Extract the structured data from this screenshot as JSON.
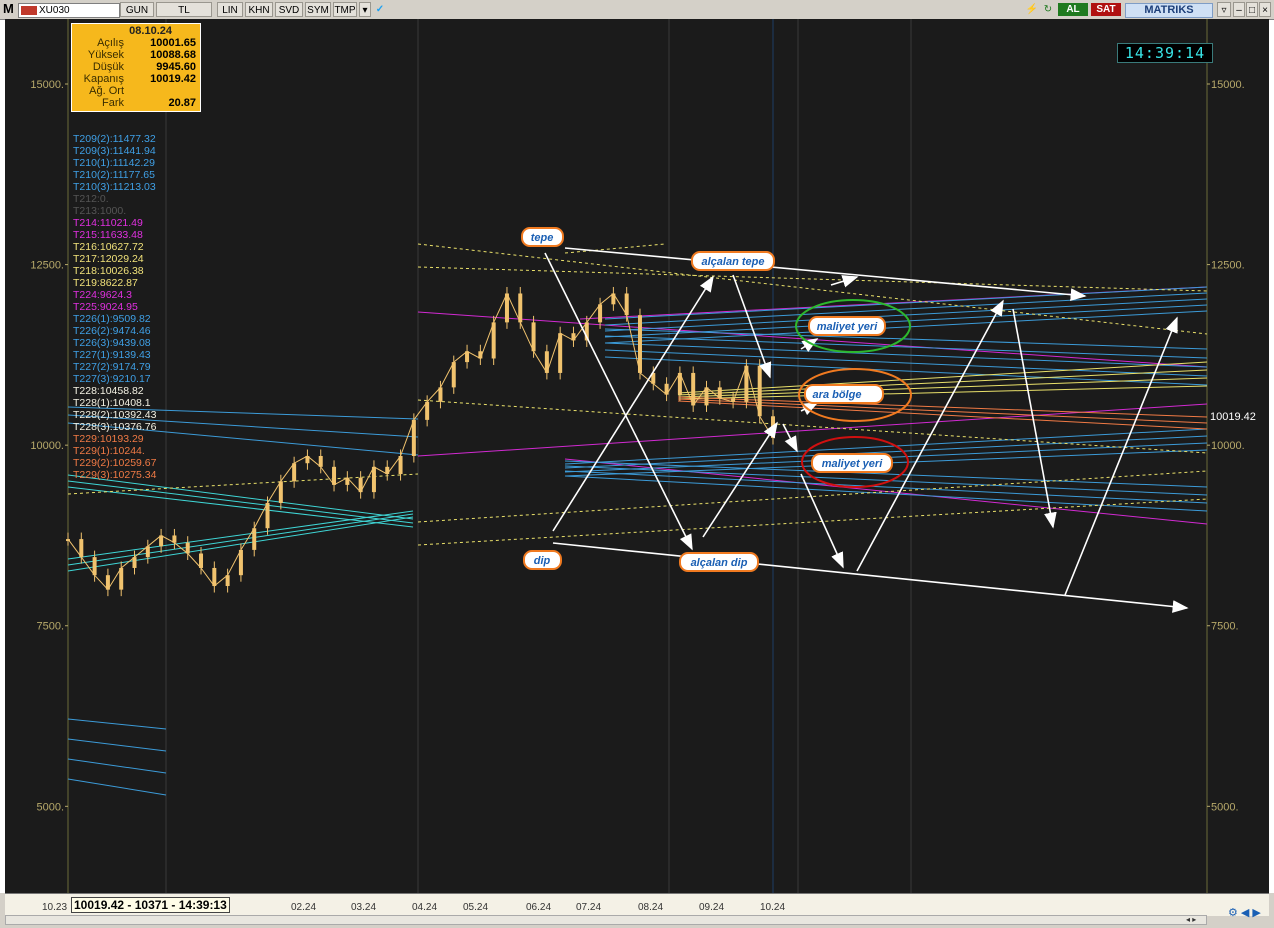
{
  "toolbar": {
    "logo": "M",
    "symbol": "XU030",
    "buttons": [
      "GUN",
      "TL",
      "LIN",
      "KHN",
      "SVD",
      "SYM",
      "TMP"
    ],
    "al_label": "AL",
    "sat_label": "SAT",
    "brand": "MATRIKS"
  },
  "clock": "14:39:14",
  "info_box": {
    "date": "08.10.24",
    "rows": [
      {
        "label": "Açılış",
        "value": "10001.65"
      },
      {
        "label": "Yüksek",
        "value": "10088.68"
      },
      {
        "label": "Düşük",
        "value": "9945.60"
      },
      {
        "label": "Kapanış",
        "value": "10019.42"
      },
      {
        "label": "Ağ. Ort",
        "value": ""
      },
      {
        "label": "Fark",
        "value": "20.87"
      }
    ]
  },
  "levels": [
    {
      "text": "T209(2):11477.32",
      "color": "#3fa0e6"
    },
    {
      "text": "T209(3):11441.94",
      "color": "#3fa0e6"
    },
    {
      "text": "T210(1):11142.29",
      "color": "#3fa0e6"
    },
    {
      "text": "T210(2):11177.65",
      "color": "#3fa0e6"
    },
    {
      "text": "T210(3):11213.03",
      "color": "#3fa0e6"
    },
    {
      "text": "T212:0.",
      "color": "#555555"
    },
    {
      "text": "T213:1000.",
      "color": "#555555"
    },
    {
      "text": "T214:11021.49",
      "color": "#e030e0"
    },
    {
      "text": "T215:11633.48",
      "color": "#e030e0"
    },
    {
      "text": "T216:10627.72",
      "color": "#f1e27a"
    },
    {
      "text": "T217:12029.24",
      "color": "#f1e27a"
    },
    {
      "text": "T218:10026.38",
      "color": "#f1e27a"
    },
    {
      "text": "T219:8622.87",
      "color": "#f1e27a"
    },
    {
      "text": "T224:9624.3",
      "color": "#e030e0"
    },
    {
      "text": "T225:9024.95",
      "color": "#e030e0"
    },
    {
      "text": "T226(1):9509.82",
      "color": "#3fa0e6"
    },
    {
      "text": "T226(2):9474.46",
      "color": "#3fa0e6"
    },
    {
      "text": "T226(3):9439.08",
      "color": "#3fa0e6"
    },
    {
      "text": "T227(1):9139.43",
      "color": "#3fa0e6"
    },
    {
      "text": "T227(2):9174.79",
      "color": "#3fa0e6"
    },
    {
      "text": "T227(3):9210.17",
      "color": "#3fa0e6"
    },
    {
      "text": "T228:10458.82",
      "color": "#f4f2e4"
    },
    {
      "text": "T228(1):10408.1",
      "color": "#f4f2e4"
    },
    {
      "text": "T228(2):10392.43",
      "color": "#f4f2e4"
    },
    {
      "text": "T228(3):10376.76",
      "color": "#f4f2e4"
    },
    {
      "text": "T229:10193.29",
      "color": "#f07a45"
    },
    {
      "text": "T229(1):10244.",
      "color": "#f07a45"
    },
    {
      "text": "T229(2):10259.67",
      "color": "#f07a45"
    },
    {
      "text": "T229(3):10275.34",
      "color": "#f07a45"
    }
  ],
  "annotations": {
    "tepe": "tepe",
    "alcalan_tepe": "alçalan tepe",
    "maliyet_yeri_top": "maliyet yeri",
    "ara_bolge": "ara bölge",
    "maliyet_yeri_bottom": "maliyet yeri",
    "dip": "dip",
    "alcalan_dip": "alçalan dip"
  },
  "status_readout": "10019.42 - 10371 - 14:39:13",
  "chart_data": {
    "type": "candlestick",
    "symbol": "XU030",
    "y_ticks": [
      15000,
      12500,
      10000,
      7500,
      5000
    ],
    "y_tick_labels": [
      "15000.",
      "12500.",
      "10000.",
      "7500.",
      "5000."
    ],
    "ylim": [
      3800,
      15900
    ],
    "last_price": "10019.42",
    "x_tick_labels": [
      "10.23",
      "02.24",
      "03.24",
      "04.24",
      "05.24",
      "06.24",
      "07.24",
      "08.24",
      "09.24",
      "10.24"
    ],
    "price_path": [
      [
        0,
        8700
      ],
      [
        2,
        8450
      ],
      [
        4,
        8200
      ],
      [
        6,
        8000
      ],
      [
        8,
        8300
      ],
      [
        10,
        8450
      ],
      [
        12,
        8600
      ],
      [
        14,
        8750
      ],
      [
        16,
        8650
      ],
      [
        18,
        8500
      ],
      [
        20,
        8300
      ],
      [
        22,
        8050
      ],
      [
        24,
        8200
      ],
      [
        26,
        8550
      ],
      [
        28,
        8850
      ],
      [
        30,
        9200
      ],
      [
        32,
        9500
      ],
      [
        34,
        9750
      ],
      [
        36,
        9850
      ],
      [
        38,
        9700
      ],
      [
        40,
        9450
      ],
      [
        42,
        9550
      ],
      [
        44,
        9350
      ],
      [
        46,
        9700
      ],
      [
        48,
        9600
      ],
      [
        50,
        9850
      ],
      [
        52,
        10350
      ],
      [
        54,
        10600
      ],
      [
        56,
        10800
      ],
      [
        58,
        11150
      ],
      [
        60,
        11300
      ],
      [
        62,
        11200
      ],
      [
        64,
        11700
      ],
      [
        66,
        12100
      ],
      [
        68,
        11700
      ],
      [
        70,
        11300
      ],
      [
        72,
        11000
      ],
      [
        74,
        11550
      ],
      [
        76,
        11450
      ],
      [
        78,
        11700
      ],
      [
        80,
        11950
      ],
      [
        82,
        12100
      ],
      [
        84,
        11800
      ],
      [
        86,
        11000
      ],
      [
        88,
        10850
      ],
      [
        90,
        10700
      ],
      [
        92,
        11000
      ],
      [
        94,
        10550
      ],
      [
        96,
        10800
      ],
      [
        98,
        10650
      ],
      [
        100,
        10600
      ],
      [
        102,
        11100
      ],
      [
        104,
        10400
      ],
      [
        106,
        10100
      ]
    ]
  }
}
